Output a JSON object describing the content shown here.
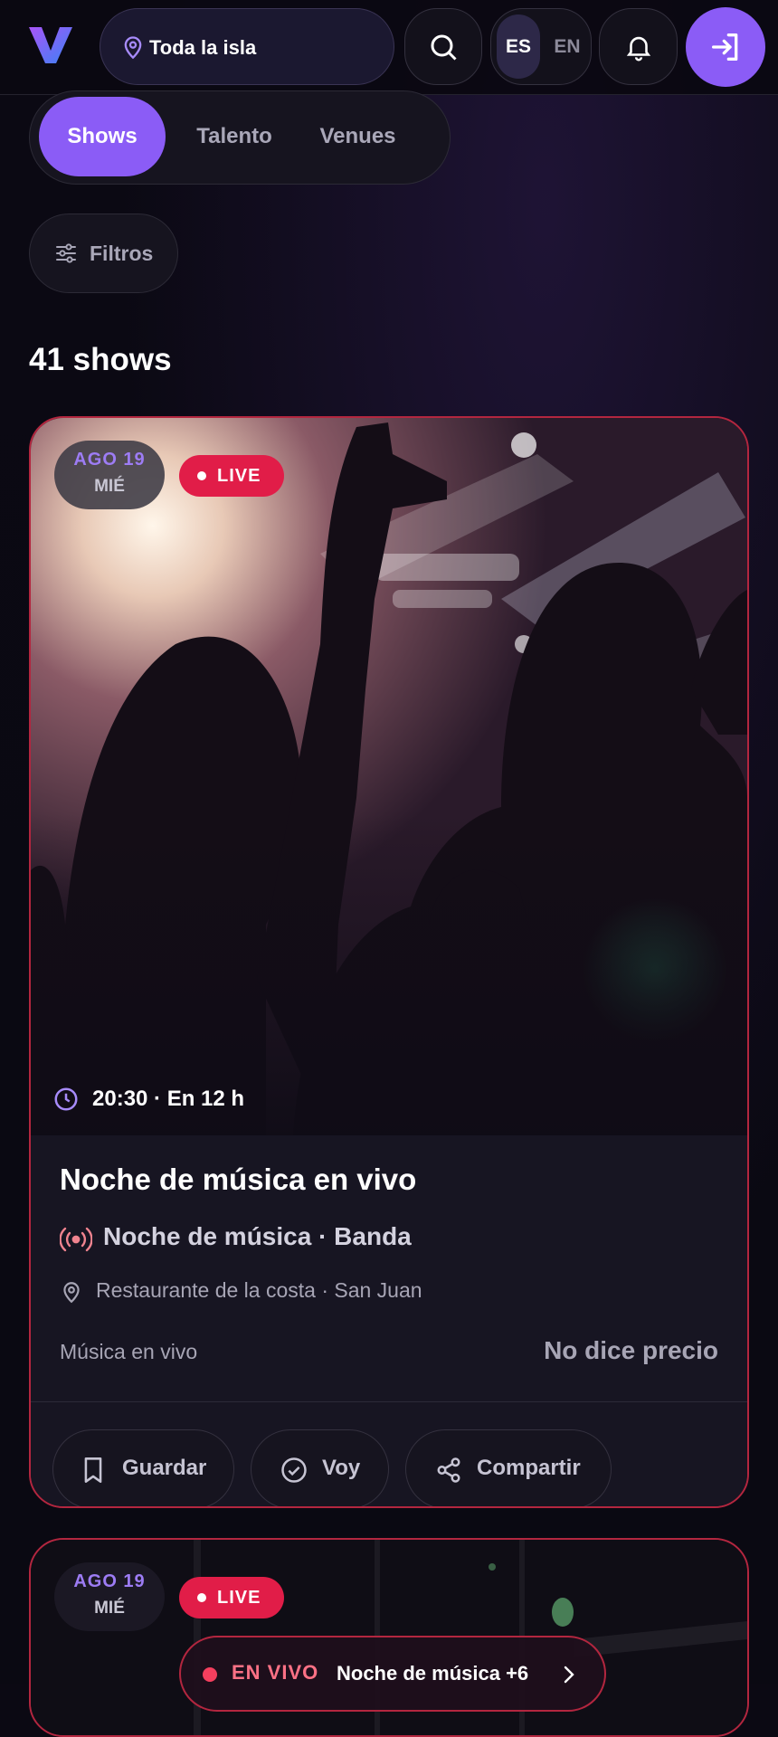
{
  "header": {
    "location_label": "Toda la isla",
    "lang_es": "ES",
    "lang_en": "EN"
  },
  "tabs": [
    {
      "label": "Shows",
      "active": true
    },
    {
      "label": "Talento",
      "active": false
    },
    {
      "label": "Venues",
      "active": false
    }
  ],
  "filters_label": "Filtros",
  "results_count": "41 shows",
  "cards": [
    {
      "month_day": "AGO 19",
      "weekday": "MIÉ",
      "live_label": "LIVE",
      "time": "20:30 · En 12 h",
      "title": "Noche de música en vivo",
      "subtitle": "Noche de música · Banda",
      "venue": "Restaurante de la costa · San Juan",
      "genre": "Música en vivo",
      "price": "No dice precio",
      "actions": {
        "save": "Guardar",
        "going": "Voy",
        "share": "Compartir"
      }
    },
    {
      "month_day": "AGO 19",
      "weekday": "MIÉ",
      "live_label": "LIVE",
      "now_label": "EN VIVO",
      "now_text": "Noche de música +6"
    }
  ],
  "colors": {
    "accent": "#8b5cf6",
    "live": "#e11d48",
    "background": "#0b0913",
    "card_border": "#b3263f"
  }
}
